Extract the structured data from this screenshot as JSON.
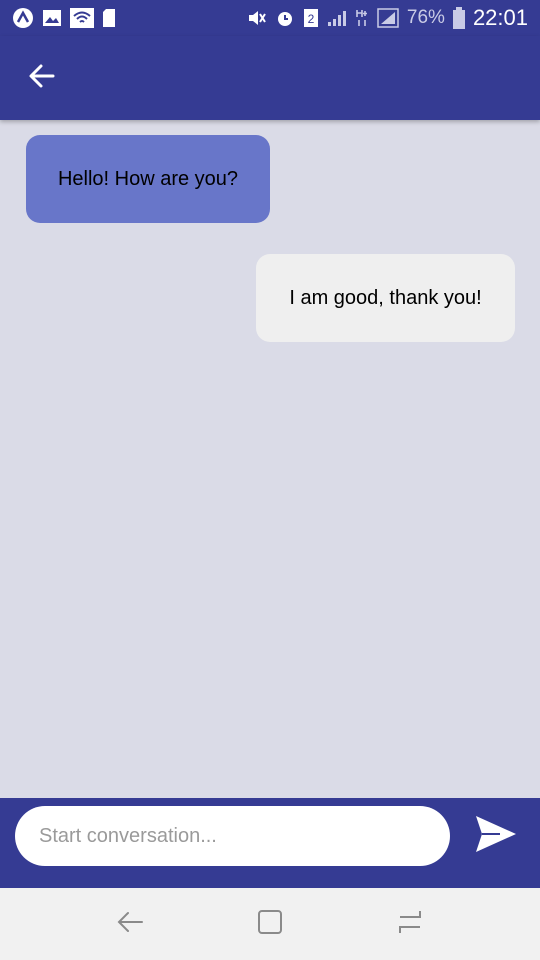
{
  "status_bar": {
    "left_icons": [
      "app-notification-icon",
      "image-icon",
      "wifi-icon",
      "sd-card-icon"
    ],
    "right_icons": [
      "mute-icon",
      "alarm-icon",
      "sim-2-icon",
      "signal-icon",
      "data-hplus-icon",
      "signal-icon",
      "battery-icon"
    ],
    "battery_percent": "76%",
    "time": "22:01"
  },
  "app_bar": {
    "back_icon": "arrow-left-icon"
  },
  "messages": [
    {
      "direction": "incoming",
      "text": "Hello! How are you?"
    },
    {
      "direction": "outgoing",
      "text": "I am good, thank you!"
    }
  ],
  "composer": {
    "placeholder": "Start conversation...",
    "value": "",
    "send_icon": "send-icon"
  },
  "nav_bar": {
    "buttons": [
      "back-icon",
      "home-icon",
      "recents-icon"
    ]
  },
  "colors": {
    "primary": "#353b93",
    "incoming_bubble": "#6876c9",
    "outgoing_bubble": "#efefef",
    "chat_background": "#dadbe7"
  }
}
